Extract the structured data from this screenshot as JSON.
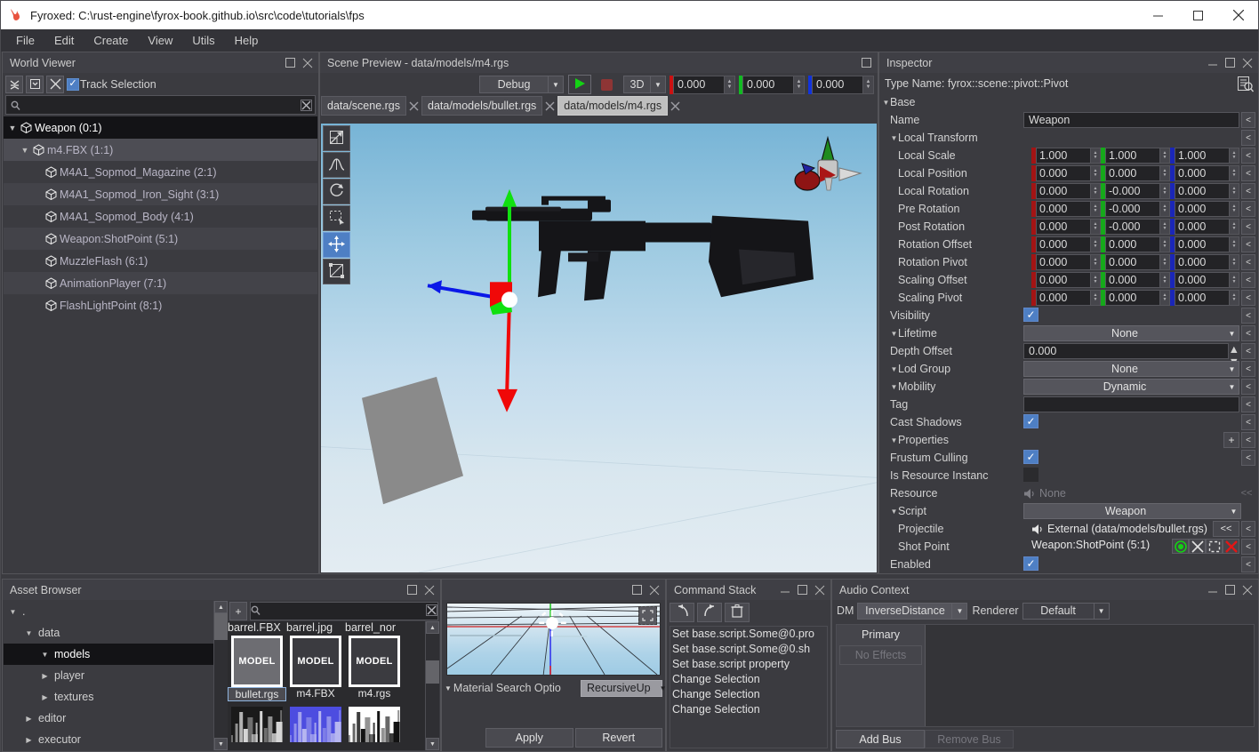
{
  "window": {
    "title": "Fyroxed: C:\\rust-engine\\fyrox-book.github.io\\src\\code\\tutorials\\fps",
    "logo_icon": "fyrox-flame-logo",
    "minimize_icon": "minimize-icon",
    "maximize_icon": "maximize-icon",
    "close_icon": "close-icon"
  },
  "menubar": {
    "items": [
      {
        "label": "File"
      },
      {
        "label": "Edit"
      },
      {
        "label": "Create"
      },
      {
        "label": "View"
      },
      {
        "label": "Utils"
      },
      {
        "label": "Help"
      }
    ]
  },
  "world_viewer": {
    "title": "World Viewer",
    "toolbar": {
      "collapse_all_icon": "collapse-all-icon",
      "expand_all_icon": "expand-all-icon",
      "locate_selection_icon": "locate-selection-icon",
      "track_selection_label": "Track Selection",
      "track_selection_checked": true
    },
    "search": {
      "value": "",
      "placeholder": "",
      "search_icon": "search-icon",
      "clear_icon": "clear-icon"
    },
    "tree": [
      {
        "label": "Weapon (0:1)",
        "indent": 0,
        "expanded": true,
        "state": "selected"
      },
      {
        "label": "m4.FBX (1:1)",
        "indent": 1,
        "expanded": true,
        "state": "hover"
      },
      {
        "label": "M4A1_Sopmod_Magazine (2:1)",
        "indent": 2,
        "expanded": false,
        "state": "normal"
      },
      {
        "label": "M4A1_Sopmod_Iron_Sight (3:1)",
        "indent": 2,
        "expanded": false,
        "state": "alt"
      },
      {
        "label": "M4A1_Sopmod_Body (4:1)",
        "indent": 2,
        "expanded": false,
        "state": "normal"
      },
      {
        "label": "Weapon:ShotPoint (5:1)",
        "indent": 2,
        "expanded": false,
        "state": "alt"
      },
      {
        "label": "MuzzleFlash (6:1)",
        "indent": 2,
        "expanded": false,
        "state": "normal"
      },
      {
        "label": "AnimationPlayer (7:1)",
        "indent": 2,
        "expanded": false,
        "state": "alt"
      },
      {
        "label": "FlashLightPoint (8:1)",
        "indent": 2,
        "expanded": false,
        "state": "normal"
      }
    ]
  },
  "scene_preview": {
    "title": "Scene Preview - data/models/m4.rgs",
    "maximize_icon": "maximize-icon",
    "toolbar": {
      "build_profile": "Debug",
      "play_icon": "play-icon",
      "stop_icon": "stop-icon",
      "mode": "3D",
      "x_value": "0.000",
      "y_value": "0.000",
      "z_value": "0.000",
      "x_color": "#cc1111",
      "y_color": "#11bb22",
      "z_color": "#1133dd"
    },
    "tabs": [
      {
        "label": "data/scene.rgs",
        "active": false
      },
      {
        "label": "data/models/bullet.rgs",
        "active": false
      },
      {
        "label": "data/models/m4.rgs",
        "active": true
      }
    ],
    "viewport_tools": [
      {
        "name": "select-tool",
        "icon": "arrow-select-icon",
        "active": false
      },
      {
        "name": "terrain-tool",
        "icon": "terrain-icon",
        "active": false
      },
      {
        "name": "rotate-tool",
        "icon": "rotate-icon",
        "active": false
      },
      {
        "name": "rect-select-tool",
        "icon": "rect-select-icon",
        "active": false
      },
      {
        "name": "move-tool",
        "icon": "move-gizmo-icon",
        "active": true
      },
      {
        "name": "scale-tool",
        "icon": "scale-icon",
        "active": false
      }
    ]
  },
  "inspector": {
    "title": "Inspector",
    "minimize_icon": "minimize-icon",
    "maximize_icon": "maximize-icon",
    "close_icon": "close-icon",
    "type_name": "Type Name: fyrox::scene::pivot::Pivot",
    "doc_icon": "document-search-icon",
    "rows": [
      {
        "kind": "group",
        "label": "Base",
        "indent": 0,
        "expanded": true
      },
      {
        "kind": "text",
        "label": "Name",
        "indent": 1,
        "value": "Weapon"
      },
      {
        "kind": "group",
        "label": "Local Transform",
        "indent": 1,
        "expanded": true
      },
      {
        "kind": "vec3",
        "label": "Local Scale",
        "indent": 2,
        "values": [
          "1.000",
          "1.000",
          "1.000"
        ]
      },
      {
        "kind": "vec3",
        "label": "Local Position",
        "indent": 2,
        "values": [
          "0.000",
          "0.000",
          "0.000"
        ]
      },
      {
        "kind": "vec3",
        "label": "Local Rotation",
        "indent": 2,
        "values": [
          "0.000",
          "-0.000",
          "0.000"
        ]
      },
      {
        "kind": "vec3",
        "label": "Pre Rotation",
        "indent": 2,
        "values": [
          "0.000",
          "-0.000",
          "0.000"
        ]
      },
      {
        "kind": "vec3",
        "label": "Post Rotation",
        "indent": 2,
        "values": [
          "0.000",
          "-0.000",
          "0.000"
        ]
      },
      {
        "kind": "vec3",
        "label": "Rotation Offset",
        "indent": 2,
        "values": [
          "0.000",
          "0.000",
          "0.000"
        ]
      },
      {
        "kind": "vec3",
        "label": "Rotation Pivot",
        "indent": 2,
        "values": [
          "0.000",
          "0.000",
          "0.000"
        ]
      },
      {
        "kind": "vec3",
        "label": "Scaling Offset",
        "indent": 2,
        "values": [
          "0.000",
          "0.000",
          "0.000"
        ]
      },
      {
        "kind": "vec3",
        "label": "Scaling Pivot",
        "indent": 2,
        "values": [
          "0.000",
          "0.000",
          "0.000"
        ]
      },
      {
        "kind": "check",
        "label": "Visibility",
        "indent": 1,
        "checked": true
      },
      {
        "kind": "combo",
        "label": "Lifetime",
        "indent": 1,
        "expanded": true,
        "value": "None"
      },
      {
        "kind": "num",
        "label": "Depth Offset",
        "indent": 1,
        "value": "0.000"
      },
      {
        "kind": "combo",
        "label": "Lod Group",
        "indent": 1,
        "expanded": true,
        "value": "None"
      },
      {
        "kind": "combo",
        "label": "Mobility",
        "indent": 1,
        "expanded": true,
        "value": "Dynamic"
      },
      {
        "kind": "text",
        "label": "Tag",
        "indent": 1,
        "value": ""
      },
      {
        "kind": "check",
        "label": "Cast Shadows",
        "indent": 1,
        "checked": true
      },
      {
        "kind": "group-plus",
        "label": "Properties",
        "indent": 1,
        "expanded": true,
        "plus_label": "+"
      },
      {
        "kind": "check",
        "label": "Frustum Culling",
        "indent": 1,
        "checked": true
      },
      {
        "kind": "check-dark",
        "label": "Is Resource Instanc",
        "indent": 1,
        "checked": false
      },
      {
        "kind": "resource",
        "label": "Resource",
        "indent": 1,
        "value": "None",
        "speaker_icon": "audio-resource-icon",
        "double_arrow": "<<"
      },
      {
        "kind": "script",
        "label": "Script",
        "indent": 1,
        "expanded": true,
        "value": "Weapon"
      },
      {
        "kind": "resource-set",
        "label": "Projectile",
        "indent": 2,
        "value": "External (data/models/bullet.rgs)",
        "speaker_icon": "audio-resource-icon",
        "double_arrow": "<<"
      },
      {
        "kind": "node-ref",
        "label": "Shot Point",
        "indent": 2,
        "value": "Weapon:ShotPoint (5:1)",
        "icons": [
          "locate-node-icon",
          "unassign-node-icon",
          "pick-node-icon",
          "clear-node-icon"
        ]
      },
      {
        "kind": "check",
        "label": "Enabled",
        "indent": 1,
        "checked": true
      }
    ],
    "reset_label": "<"
  },
  "asset_browser": {
    "title": "Asset Browser",
    "maximize_icon": "maximize-icon",
    "close_icon": "close-icon",
    "tree": [
      {
        "label": ".",
        "indent": 0,
        "expanded": true,
        "selected": false
      },
      {
        "label": "data",
        "indent": 1,
        "expanded": true,
        "selected": false
      },
      {
        "label": "models",
        "indent": 2,
        "expanded": true,
        "selected": true
      },
      {
        "label": "player",
        "indent": 2,
        "expanded": false,
        "selected": false
      },
      {
        "label": "textures",
        "indent": 2,
        "expanded": false,
        "selected": false
      },
      {
        "label": "editor",
        "indent": 1,
        "expanded": false,
        "selected": false
      },
      {
        "label": "executor",
        "indent": 1,
        "expanded": false,
        "selected": false
      }
    ],
    "search": {
      "value": "",
      "placeholder": "",
      "search_icon": "search-icon",
      "clear_icon": "clear-icon"
    },
    "add_label": "+",
    "partial_top_row": [
      "barrel.FBX",
      "barrel.jpg",
      "barrel_nor"
    ],
    "items": [
      {
        "name": "bullet.rgs",
        "thumb_label": "MODEL",
        "selected": true
      },
      {
        "name": "m4.FBX",
        "thumb_label": "MODEL",
        "selected": false
      },
      {
        "name": "m4.rgs",
        "thumb_label": "MODEL",
        "selected": false
      }
    ]
  },
  "material_panel": {
    "maximize_icon": "maximize-icon",
    "close_icon": "close-icon",
    "fit_icon": "fit-to-view-icon",
    "search_options_label": "Material Search Optio",
    "search_mode": "RecursiveUp",
    "apply_label": "Apply",
    "revert_label": "Revert"
  },
  "command_stack": {
    "title": "Command Stack",
    "minimize_icon": "minimize-icon",
    "maximize_icon": "maximize-icon",
    "close_icon": "close-icon",
    "undo_icon": "undo-icon",
    "redo_icon": "redo-icon",
    "clear_icon": "trash-icon",
    "items": [
      "Set base.script.Some@0.pro",
      "Set base.script.Some@0.sh",
      "Set base.script property",
      "Change Selection",
      "Change Selection",
      "Change Selection"
    ]
  },
  "audio_context": {
    "title": "Audio Context",
    "minimize_icon": "minimize-icon",
    "maximize_icon": "maximize-icon",
    "close_icon": "close-icon",
    "dm_label": "DM",
    "dm_value": "InverseDistance",
    "renderer_label": "Renderer",
    "renderer_value": "Default",
    "bus_header": "Primary",
    "no_effects": "No Effects",
    "add_bus": "Add Bus",
    "remove_bus": "Remove Bus"
  }
}
